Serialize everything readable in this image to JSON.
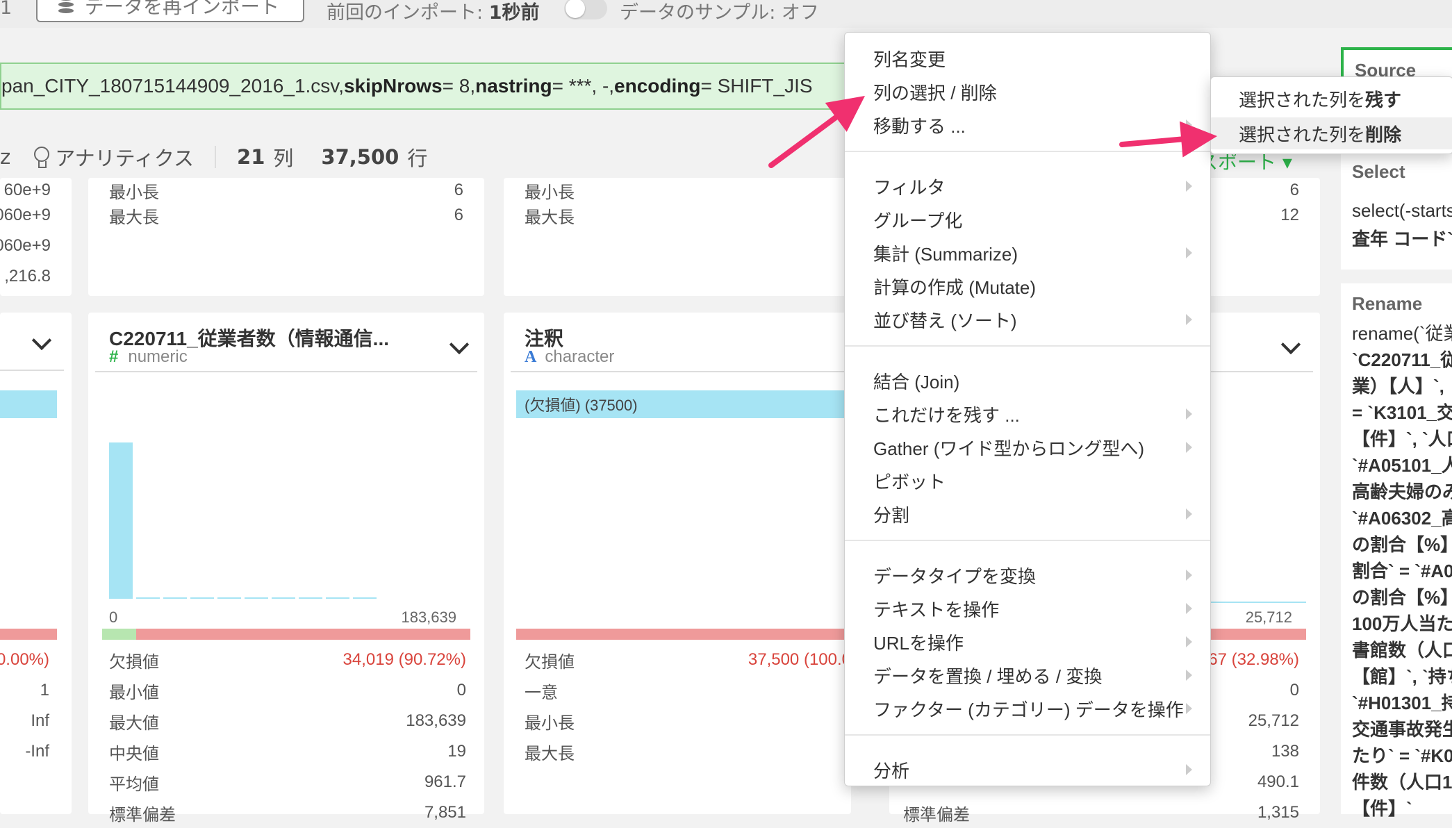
{
  "topbar": {
    "left_digit": "1",
    "reimport_label": "データを再インポート",
    "prev_import_prefix": "前回のインポート: ",
    "prev_import_value": "1秒前",
    "sample_label": "データのサンプル: オフ"
  },
  "command": {
    "file": "pan_CITY_180715144909_2016_1.csv, ",
    "arg1_name": "skipNrows",
    "arg1_val": " = 8, ",
    "arg2_name": "nastring",
    "arg2_val": " = ***, -, ",
    "arg3_name": "encoding",
    "arg3_val": " = SHIFT_JIS"
  },
  "toolbar": {
    "z_label": "z",
    "analytics_label": "アナリティクス",
    "cols_count": "21",
    "cols_unit": "列",
    "rows_count": "37,500",
    "rows_unit": "行"
  },
  "top_left_col": {
    "values": [
      "60e+9",
      "060e+9",
      "060e+9",
      ",216.8"
    ]
  },
  "top_card1": {
    "rows": [
      {
        "label": "最小長",
        "value": "6"
      },
      {
        "label": "最大長",
        "value": "6"
      }
    ]
  },
  "top_card2": {
    "rows": [
      {
        "label": "最小長",
        "value": ""
      },
      {
        "label": "最大長",
        "value": ""
      }
    ]
  },
  "top_card3": {
    "rows": [
      {
        "label": "",
        "value": "6"
      },
      {
        "label": "",
        "value": "12"
      }
    ]
  },
  "export_partial": "スポート ▾",
  "left_col2": {
    "rows": [
      {
        "value": "0.00%)"
      },
      {
        "value": "1"
      },
      {
        "value": "Inf"
      },
      {
        "value": "-Inf"
      }
    ]
  },
  "card_c220711": {
    "title": "C220711_従業者数（情報通信...",
    "type": "numeric",
    "type_icon": "#",
    "axis_min": "0",
    "axis_max": "183,639",
    "histogram": [
      1.0,
      0,
      0,
      0,
      0,
      0,
      0,
      0,
      0,
      0
    ],
    "missing_fraction": 0.9072,
    "stats": [
      {
        "label": "欠損値",
        "value": "34,019 (90.72%)",
        "red": true
      },
      {
        "label": "最小値",
        "value": "0"
      },
      {
        "label": "最大値",
        "value": "183,639"
      },
      {
        "label": "中央値",
        "value": "19"
      },
      {
        "label": "平均値",
        "value": "961.7"
      },
      {
        "label": "標準偏差",
        "value": "7,851"
      }
    ]
  },
  "card_note": {
    "title": "注釈",
    "type": "character",
    "type_icon": "A",
    "bar_label": "(欠損値) (37500)",
    "stats": [
      {
        "label": "欠損値",
        "value": "37,500 (100.0",
        "red": true
      },
      {
        "label": "一意",
        "value": ""
      },
      {
        "label": "最小長",
        "value": ""
      },
      {
        "label": "最大長",
        "value": ""
      }
    ]
  },
  "card_right": {
    "axis_max": "25,712",
    "stats": [
      {
        "label": "",
        "value": "67 (32.98%)",
        "red": true
      },
      {
        "label": "",
        "value": "0"
      },
      {
        "label": "",
        "value": "25,712"
      },
      {
        "label": "",
        "value": "138"
      },
      {
        "label": "",
        "value": "490.1"
      },
      {
        "label": "標準偏差",
        "value": "1,315"
      }
    ]
  },
  "context_menu": {
    "groups": [
      [
        {
          "label": "列名変更",
          "sub": false
        },
        {
          "label": "列の選択 / 削除",
          "sub": false
        },
        {
          "label": "移動する ...",
          "sub": true
        }
      ],
      [
        {
          "label": "フィルタ",
          "sub": true
        },
        {
          "label": "グループ化",
          "sub": false
        },
        {
          "label": "集計 (Summarize)",
          "sub": true
        },
        {
          "label": "計算の作成 (Mutate)",
          "sub": false
        },
        {
          "label": "並び替え (ソート)",
          "sub": true
        }
      ],
      [
        {
          "label": "結合 (Join)",
          "sub": false
        },
        {
          "label": "これだけを残す ...",
          "sub": true
        },
        {
          "label": "Gather (ワイド型からロング型へ)",
          "sub": true
        },
        {
          "label": "ピボット",
          "sub": false
        },
        {
          "label": "分割",
          "sub": true
        }
      ],
      [
        {
          "label": "データタイプを変換",
          "sub": true
        },
        {
          "label": "テキストを操作",
          "sub": true
        },
        {
          "label": "URLを操作",
          "sub": true
        },
        {
          "label": "データを置換 / 埋める / 変換",
          "sub": true
        },
        {
          "label": "ファクター (カテゴリー) データを操作",
          "sub": true
        }
      ],
      [
        {
          "label": "分析",
          "sub": true
        }
      ]
    ]
  },
  "submenu": {
    "keep_prefix": "選択された列を",
    "keep_bold": "残す",
    "delete_prefix": "選択された列を",
    "delete_bold": "削除"
  },
  "steps_panel": {
    "source_title": "Source",
    "select_title": "Select",
    "select_code_1": "select(-starts",
    "select_code_2": "査年 コード`",
    "rename_title": "Rename",
    "rename_lines": [
      "rename(`従業",
      "`C220711_従",
      "業）【人】`,",
      "= `K3101_交",
      "【件】`, `人口",
      "`#A05101_人",
      "高齢夫婦のみ",
      "`#A06302_高",
      "の割合【%】",
      "割合` = `#A0",
      "の割合【%】",
      "100万人当た",
      "書館数（人口",
      "【館】`, `持ち",
      "`#H01301_持",
      "交通事故発生",
      "たり` = `#K0",
      "件数（人口1",
      "【件】`"
    ]
  },
  "colors": {
    "accent_green": "#2db34a",
    "arrow_pink": "#f0306f",
    "cyan_bar": "#a6e4f4",
    "red_bar": "#ef9a9a"
  }
}
